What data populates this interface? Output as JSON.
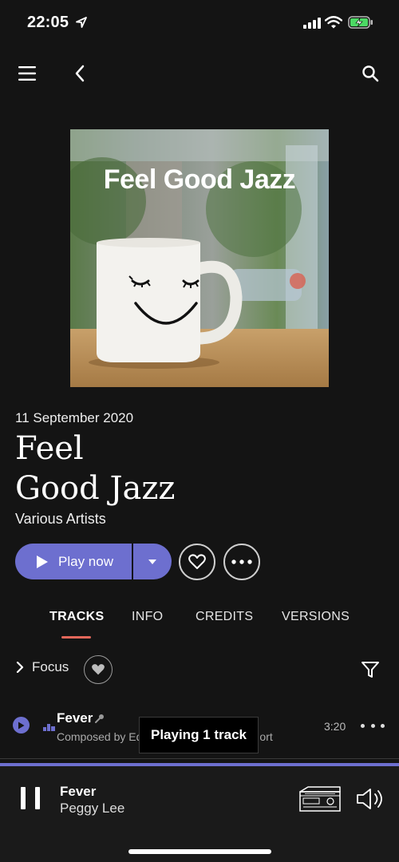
{
  "status_bar": {
    "time": "22:05",
    "icons": [
      "location-arrow-icon",
      "signal-bars-icon",
      "wifi-icon",
      "battery-charging-icon"
    ]
  },
  "topbar": {
    "icons": [
      "hamburger-menu-icon",
      "chevron-left-icon",
      "search-icon"
    ]
  },
  "album": {
    "cover_text": "Feel Good Jazz",
    "release_date": "11 September 2020",
    "title_line1": "Feel",
    "title_line2": "Good Jazz",
    "artist": "Various Artists"
  },
  "actions": {
    "play_label": "Play now",
    "icons": [
      "play-icon",
      "caret-down-icon",
      "heart-icon",
      "more-dots-icon"
    ]
  },
  "tabs": [
    {
      "label": "TRACKS",
      "active": true
    },
    {
      "label": "INFO",
      "active": false
    },
    {
      "label": "CREDITS",
      "active": false
    },
    {
      "label": "VERSIONS",
      "active": false
    }
  ],
  "filter_bar": {
    "focus_label": "Focus",
    "icons": [
      "chevron-right-icon",
      "heart-icon",
      "filter-funnel-icon"
    ]
  },
  "tracks": [
    {
      "title": "Fever",
      "composer": "Composed by Ed",
      "composer_tail": "ort",
      "duration": "3:20"
    }
  ],
  "toast": {
    "text": "Playing 1 track"
  },
  "now_playing": {
    "title": "Fever",
    "artist": "Peggy Lee",
    "progress": 1.0,
    "icons": [
      "pause-icon",
      "hifi-device-icon",
      "volume-icon"
    ]
  },
  "colors": {
    "background": "#141414",
    "accent": "#6d6fcf",
    "tab_underline": "#e2675a",
    "player_bg": "#1a1a1a"
  }
}
